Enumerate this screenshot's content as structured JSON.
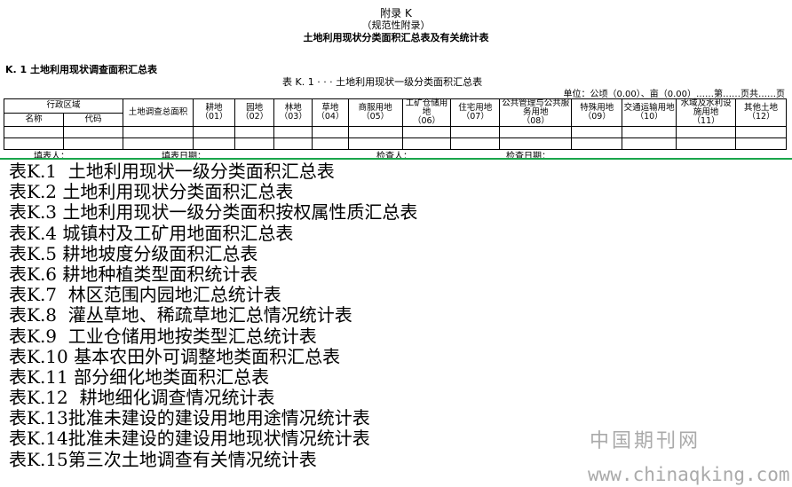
{
  "header": {
    "appendix_title": "附录 K",
    "appendix_sub": "（规范性附录）",
    "main_title": "土地利用现状分类面积汇总表及有关统计表"
  },
  "section": {
    "heading": "K. 1  土地利用现状调查面积汇总表",
    "caption": "表 K. 1 · · · 土地利用现状一级分类面积汇总表",
    "unit_line": "单位：公顷（0.00）、亩（0.00）……第……页共……页"
  },
  "table": {
    "admin_region": "行政区域",
    "name": "名称",
    "code": "代码",
    "total": "土地调查总面积",
    "columns": [
      {
        "name": "耕地",
        "code": "（01）"
      },
      {
        "name": "园地",
        "code": "（02）"
      },
      {
        "name": "林地",
        "code": "（03）"
      },
      {
        "name": "草地",
        "code": "（04）"
      },
      {
        "name": "商服用地",
        "code": "（05）"
      },
      {
        "name": "工矿仓储用地",
        "code": "（06）"
      },
      {
        "name": "住宅用地",
        "code": "（07）"
      },
      {
        "name": "公共管理与公共服务用地",
        "code": "（08）"
      },
      {
        "name": "特殊用地",
        "code": "（09）"
      },
      {
        "name": "交通运输用地",
        "code": "（10）"
      },
      {
        "name": "水域及水利设施用地",
        "code": "（11）"
      },
      {
        "name": "其他土地",
        "code": "（12）"
      }
    ]
  },
  "signatures": {
    "filler": "填表人：",
    "fill_date": "填表日期：",
    "checker": "检查人：",
    "check_date": "检查日期："
  },
  "list": [
    "表K.1  土地利用现状一级分类面积汇总表",
    "表K.2 土地利用现状分类面积汇总表",
    "表K.3 土地利用现状一级分类面积按权属性质汇总表",
    "表K.4 城镇村及工矿用地面积汇总表",
    "表K.5 耕地坡度分级面积汇总表",
    "表K.6 耕地种植类型面积统计表",
    "表K.7  林区范围内园地汇总统计表",
    "表K.8  灌丛草地、稀疏草地汇总情况统计表",
    "表K.9  工业仓储用地按类型汇总统计表",
    "表K.10 基本农田外可调整地类面积汇总表",
    "表K.11 部分细化地类面积汇总表",
    "表K.12  耕地细化调查情况统计表",
    "表K.13批准未建设的建设用地用途情况统计表",
    "表K.14批准未建设的建设用地现状情况统计表",
    "表K.15第三次土地调查有关情况统计表"
  ],
  "watermark": {
    "cn": "中国期刊网",
    "url": "www.chinaqking.com"
  },
  "colors": {
    "rule": "#1aa64b",
    "watermark": "#aaaaaa"
  }
}
